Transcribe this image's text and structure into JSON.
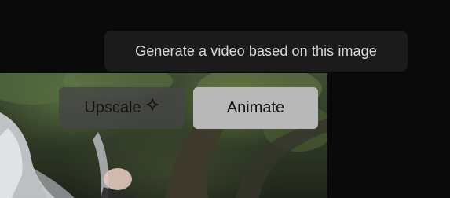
{
  "tooltip": {
    "text": "Generate a video based on this image"
  },
  "actions": {
    "upscale_label": "Upscale",
    "upscale_icon": "sparkle-icon",
    "animate_label": "Animate"
  },
  "colors": {
    "background": "#0a0a0a",
    "tooltip_bg": "#1b1b1b",
    "tooltip_text": "#d9d9d9",
    "animate_bg": "#b8b8b8",
    "upscale_bg": "#464646"
  }
}
